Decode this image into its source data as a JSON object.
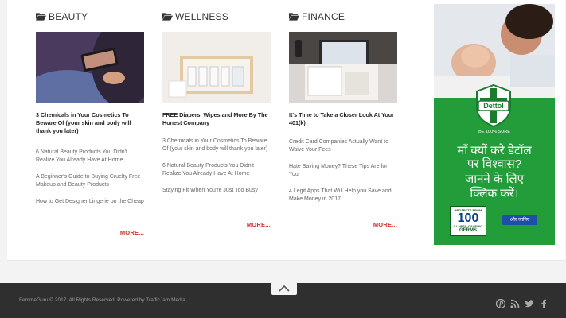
{
  "columns": [
    {
      "title": "BEAUTY",
      "lead": "3 Chemicals in Your Cosmetics To Beware Of (your skin and body will thank you later)",
      "links": [
        "6 Natural Beauty Products You Didn't Realize You Already Have At Home",
        "A Beginner's Guide to Buying Cruelty Free Makeup and Beauty Products",
        "How to Get Designer Lingerie on the Cheap"
      ],
      "more": "MORE..."
    },
    {
      "title": "WELLNESS",
      "lead": "FREE Diapers, Wipes and More By The Honest Company",
      "links": [
        "3 Chemicals in Your Cosmetics To Beware Of (your skin and body will thank you later)",
        "6 Natural Beauty Products You Didn't Realize You Already Have At Home",
        "Staying Fit When You're Just Too Busy"
      ],
      "more": "MORE..."
    },
    {
      "title": "FINANCE",
      "lead": "It's Time to Take a Closer Look At Your 401(k)",
      "links": [
        "Credit Card Companies Actually Want to Waive Your Fees",
        "Hate Saving Money? These Tips Are for You",
        "4 Legit Apps That Will Help you Save and Make Money in 2017"
      ],
      "more": "MORE..."
    }
  ],
  "ad": {
    "brand": "Dettol",
    "brand_sub": "BE 100% SURE",
    "headline_1": "माँ क्यों करे डेटॉल",
    "headline_2": "पर विश्वास?",
    "headline_3": "जानने के लिए",
    "headline_4": "क्लिक करें।",
    "badge_top": "PROTECTS FROM",
    "badge_number": "100",
    "badge_mid": "ILLNESS-CAUSING",
    "badge_bottom": "GERMS",
    "cta": "और जानिए"
  },
  "footer": {
    "copyright": "FemmeGuru © 2017. All Rights Reserved. Powered by TrafficJam Media"
  },
  "colors": {
    "more": "#d03030",
    "footer_bg": "#2f2f2f",
    "ad_green": "#239c3a"
  }
}
